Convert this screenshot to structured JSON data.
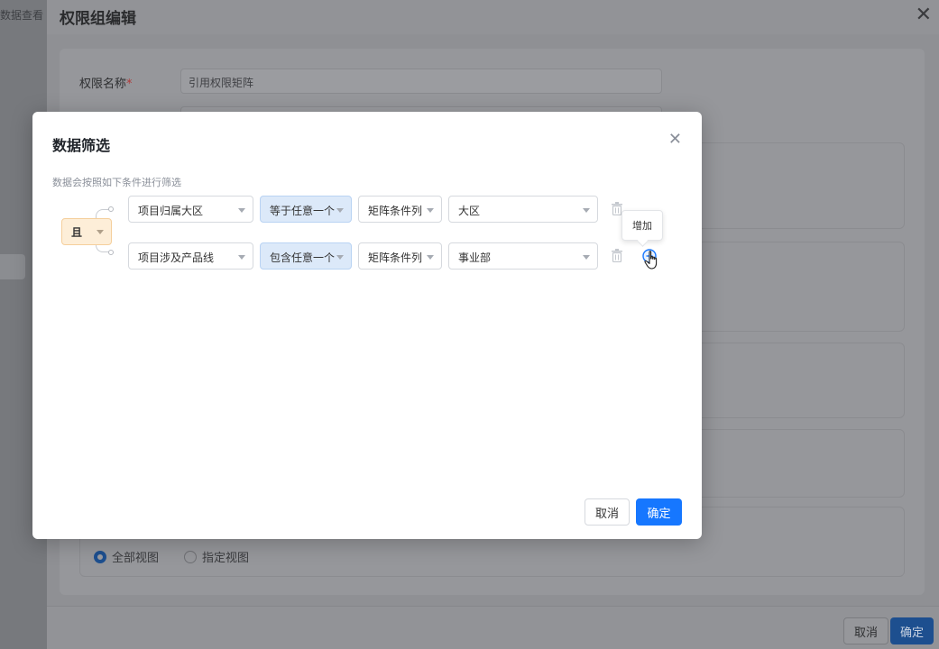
{
  "background": {
    "left_title": "数据查看",
    "drawer": {
      "title": "权限组编辑",
      "name_label": "权限名称",
      "required_mark": "*",
      "name_value": "引用权限矩阵",
      "radio_all_label": "全部视图",
      "radio_specific_label": "指定视图",
      "radio_selected": "全部视图",
      "cancel_label": "取消",
      "ok_label": "确定"
    }
  },
  "modal": {
    "title": "数据筛选",
    "hint": "数据会按照如下条件进行筛选",
    "logic_label": "且",
    "rows": [
      {
        "field": "项目归属大区",
        "operator": "等于任意一个",
        "source": "矩阵条件列",
        "value": "大区"
      },
      {
        "field": "项目涉及产品线",
        "operator": "包含任意一个",
        "source": "矩阵条件列",
        "value": "事业部"
      }
    ],
    "tooltip": "增加",
    "cancel_label": "取消",
    "ok_label": "确定"
  },
  "colors": {
    "primary": "#1677ff",
    "logic_bg": "#fdeed8",
    "operator_bg": "#dce9f9"
  },
  "icons": [
    "close-icon",
    "caret-down-icon",
    "trash-icon",
    "plus-circle-icon",
    "hand-cursor-icon"
  ]
}
